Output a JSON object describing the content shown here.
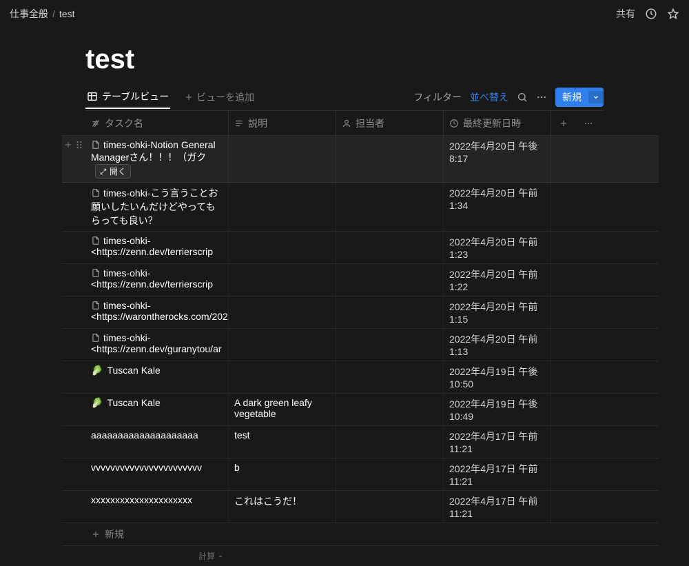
{
  "breadcrumb": {
    "parent": "仕事全般",
    "current": "test"
  },
  "topbar": {
    "share": "共有"
  },
  "page": {
    "title": "test"
  },
  "views": {
    "active_tab": "テーブルビュー",
    "add_view": "ビューを追加"
  },
  "toolbar": {
    "filter": "フィルター",
    "sort": "並べ替え",
    "new_button": "新規"
  },
  "columns": {
    "name": "タスク名",
    "desc": "説明",
    "assignee": "担当者",
    "date": "最終更新日時"
  },
  "open_pill": "開く",
  "new_row": "新規",
  "calc_label": "計算",
  "rows": [
    {
      "icon": "page",
      "name": "times-ohki-Notion General Managerさん！！！（ガク",
      "desc": "",
      "assignee": "",
      "date": "2022年4月20日 午後 8:17",
      "hovered": true
    },
    {
      "icon": "page",
      "name": "times-ohki-こう言うことお願いしたいんだけどやってもらっても良い？",
      "desc": "",
      "assignee": "",
      "date": "2022年4月20日 午前 1:34"
    },
    {
      "icon": "page",
      "name": "times-ohki-<https://zenn.dev/terrierscrip",
      "desc": "",
      "assignee": "",
      "date": "2022年4月20日 午前 1:23"
    },
    {
      "icon": "page",
      "name": "times-ohki-<https://zenn.dev/terrierscrip",
      "desc": "",
      "assignee": "",
      "date": "2022年4月20日 午前 1:22"
    },
    {
      "icon": "page",
      "name": "times-ohki-<https://warontherocks.com/202",
      "desc": "",
      "assignee": "",
      "date": "2022年4月20日 午前 1:15"
    },
    {
      "icon": "page",
      "name": "times-ohki-<https://zenn.dev/guranytou/ar",
      "desc": "",
      "assignee": "",
      "date": "2022年4月20日 午前 1:13"
    },
    {
      "icon": "leaf",
      "name": "Tuscan Kale",
      "desc": "",
      "assignee": "",
      "date": "2022年4月19日 午後 10:50"
    },
    {
      "icon": "leaf",
      "name": "Tuscan Kale",
      "desc": "A dark green leafy vegetable",
      "assignee": "",
      "date": "2022年4月19日 午後 10:49"
    },
    {
      "icon": "",
      "name": "aaaaaaaaaaaaaaaaaaaa",
      "desc": "test",
      "assignee": "",
      "date": "2022年4月17日 午前 11:21"
    },
    {
      "icon": "",
      "name": "vvvvvvvvvvvvvvvvvvvvvvv",
      "desc": "b",
      "assignee": "",
      "date": "2022年4月17日 午前 11:21"
    },
    {
      "icon": "",
      "name": "xxxxxxxxxxxxxxxxxxxxx",
      "desc": "これはこうだ！",
      "assignee": "",
      "date": "2022年4月17日 午前 11:21"
    }
  ]
}
